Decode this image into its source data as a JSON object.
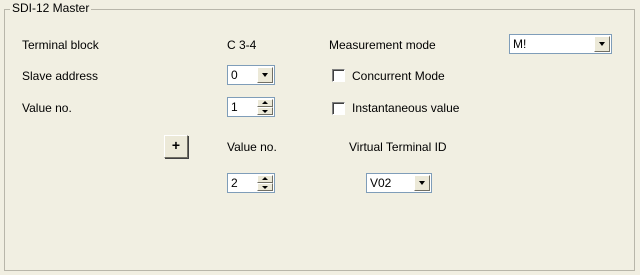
{
  "group": {
    "title": "SDI-12 Master"
  },
  "terminal_block": {
    "label": "Terminal block",
    "value": "C 3-4"
  },
  "measurement_mode": {
    "label": "Measurement mode",
    "value": "M!"
  },
  "slave_address": {
    "label": "Slave address",
    "value": "0"
  },
  "concurrent_mode": {
    "label": "Concurrent Mode",
    "checked": false
  },
  "value_no": {
    "label": "Value no.",
    "value": "1"
  },
  "instantaneous": {
    "label": "Instantaneous value",
    "checked": false
  },
  "add_button": {
    "label": "+"
  },
  "virtual_section": {
    "value_no_label": "Value no.",
    "value_no_value": "2",
    "terminal_id_label": "Virtual Terminal ID",
    "terminal_id_value": "V02"
  },
  "icons": [
    "chevron-down-icon",
    "spin-up-icon",
    "spin-down-icon"
  ],
  "colors": {
    "background": "#f1efe2",
    "field_border": "#7f9db9",
    "button_face": "#ece9d8"
  }
}
